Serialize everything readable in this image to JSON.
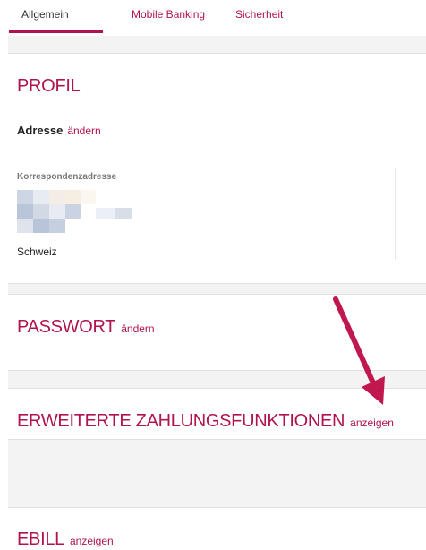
{
  "tabs": [
    {
      "label": "Allgemein",
      "active": true
    },
    {
      "label": "Mobile Banking",
      "active": false
    },
    {
      "label": "Sicherheit",
      "active": false
    }
  ],
  "profile": {
    "title": "PROFIL",
    "address_label": "Adresse",
    "address_action": "ändern",
    "correspondence_label": "Korrespondenzadresse",
    "country": "Schweiz"
  },
  "password": {
    "title": "PASSWORT",
    "action": "ändern"
  },
  "payment": {
    "title": "ERWEITERTE ZAHLUNGSFUNKTIONEN",
    "action": "anzeigen"
  },
  "ebill": {
    "title": "EBILL",
    "action": "anzeigen"
  },
  "colors": {
    "accent": "#b0134f",
    "arrow": "#c0174f",
    "band": "#f3f3f3"
  }
}
